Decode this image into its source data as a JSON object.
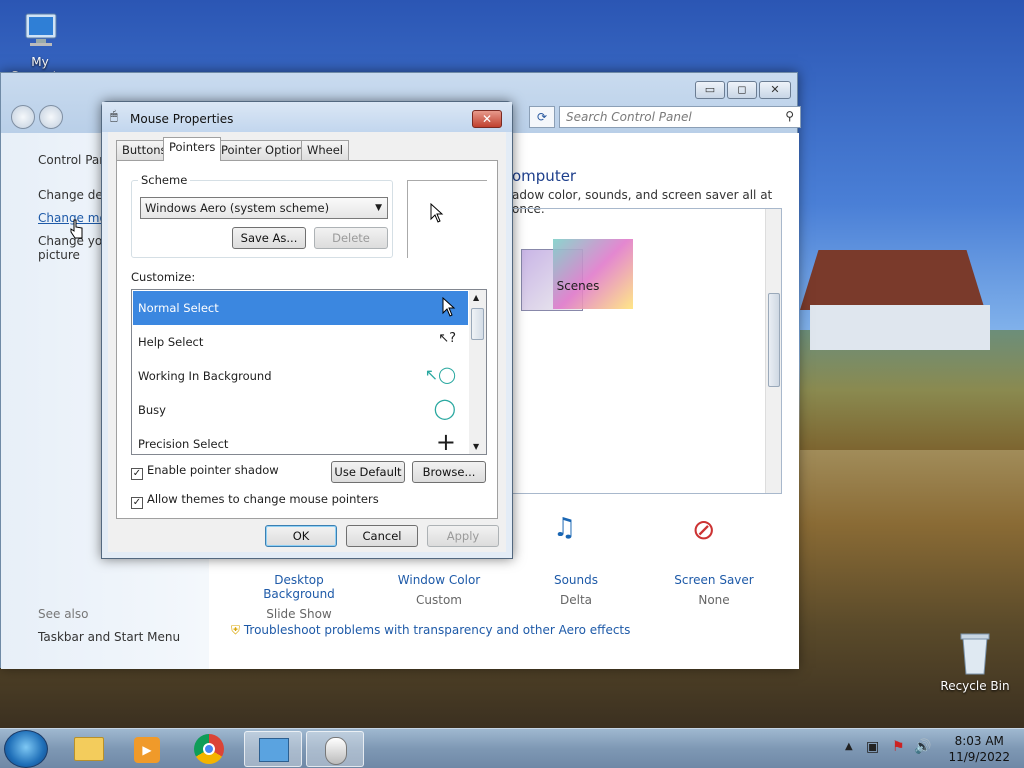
{
  "desktop": {
    "icons": {
      "my_computer": "My Computer",
      "recycle_bin": "Recycle Bin"
    }
  },
  "control_panel": {
    "window_buttons": {
      "minimize": "▭",
      "maximize": "◻",
      "close": "✕"
    },
    "search_placeholder": "Search Control Panel",
    "left": {
      "home": "Control Panel Home",
      "link1": "Change desktop icons",
      "link2": "Change mouse pointers",
      "link3": "Change your account picture",
      "see_also": "See also",
      "taskbar": "Taskbar and Start Menu"
    },
    "heading": "omputer",
    "subheading": "adow color, sounds, and screen saver all at once.",
    "theme": {
      "name": "Scenes"
    },
    "bottom_items": [
      {
        "title": "Desktop Background",
        "sub": "Slide Show"
      },
      {
        "title": "Window Color",
        "sub": "Custom"
      },
      {
        "title": "Sounds",
        "sub": "Delta"
      },
      {
        "title": "Screen Saver",
        "sub": "None"
      }
    ],
    "troubleshoot": "Troubleshoot problems with transparency and other Aero effects"
  },
  "mouse_properties": {
    "title": "Mouse Properties",
    "close": "✕",
    "tabs": [
      "Buttons",
      "Pointers",
      "Pointer Options",
      "Wheel"
    ],
    "active_tab": "Pointers",
    "scheme_label": "Scheme",
    "scheme_value": "Windows Aero (system scheme)",
    "save_as": "Save As...",
    "delete": "Delete",
    "customize_label": "Customize:",
    "pointers": [
      {
        "name": "Normal Select",
        "icon": "arrow-cursor-icon"
      },
      {
        "name": "Help Select",
        "icon": "help-cursor-icon"
      },
      {
        "name": "Working In Background",
        "icon": "working-cursor-icon"
      },
      {
        "name": "Busy",
        "icon": "busy-cursor-icon"
      },
      {
        "name": "Precision Select",
        "icon": "crosshair-cursor-icon"
      }
    ],
    "enable_shadow": "Enable pointer shadow",
    "allow_themes": "Allow themes to change mouse pointers",
    "use_default": "Use Default",
    "browse": "Browse...",
    "ok": "OK",
    "cancel": "Cancel",
    "apply": "Apply"
  },
  "taskbar": {
    "time": "8:03 AM",
    "date": "11/9/2022"
  }
}
